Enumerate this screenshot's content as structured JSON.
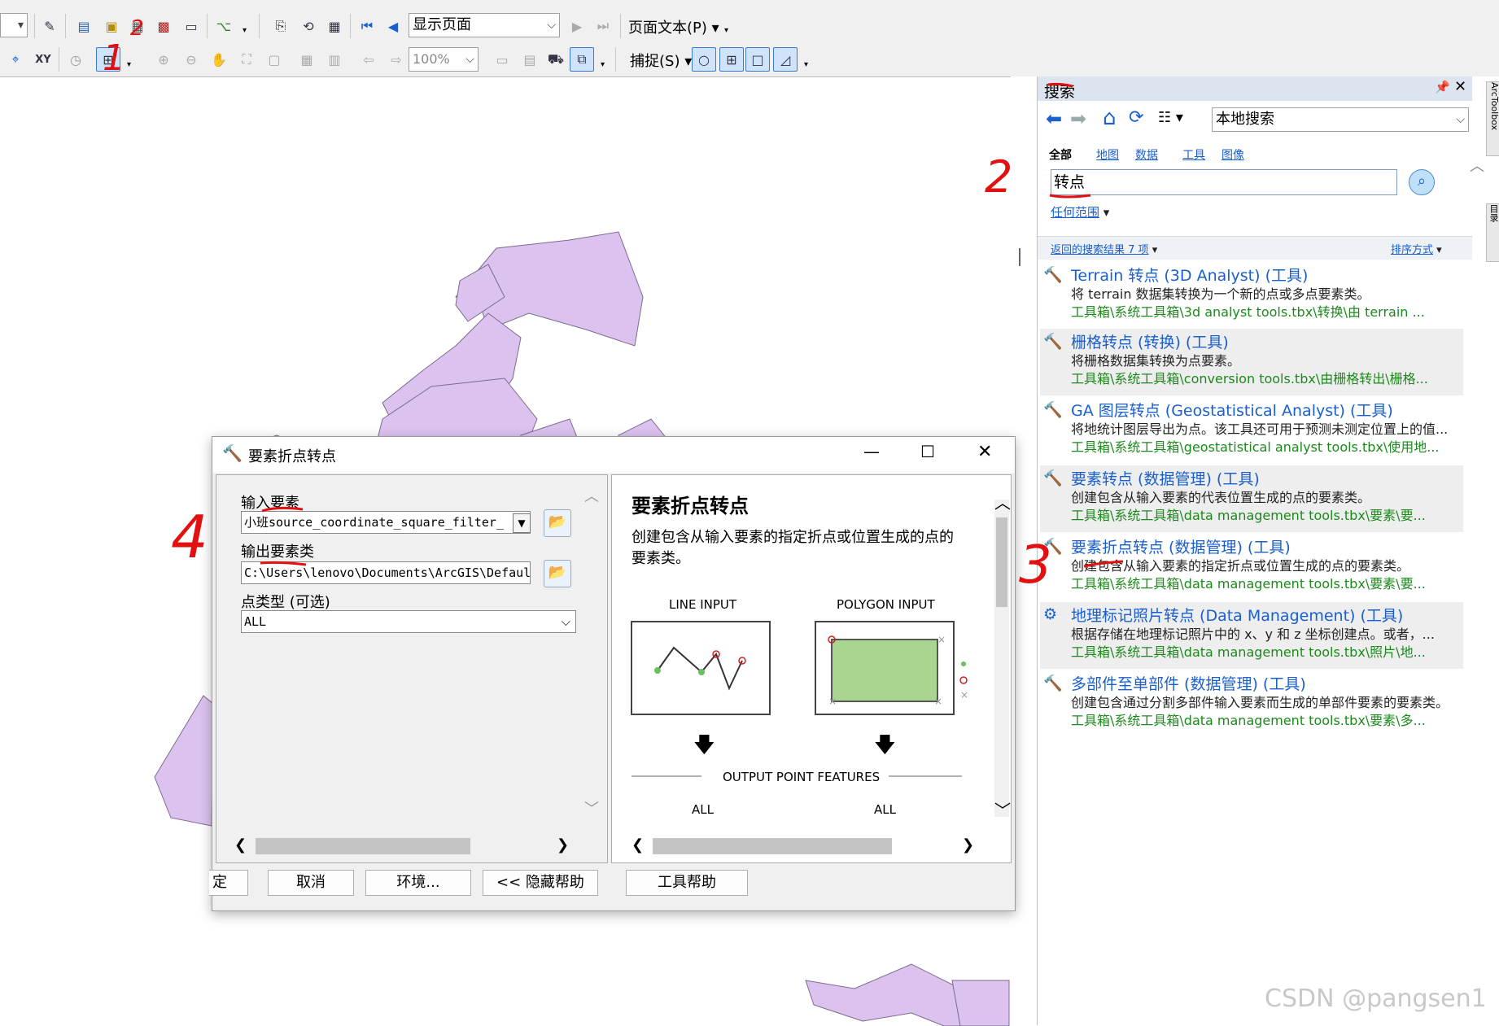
{
  "toolbar": {
    "page_combo": "显示页面",
    "page_text": "页面文本(P)",
    "zoom": "100%",
    "snap": "捕捉(S)"
  },
  "search_panel": {
    "title": "搜索",
    "scope": "本地搜索",
    "tabs": [
      "全部",
      "地图",
      "数据",
      "工具",
      "图像"
    ],
    "query": "转点",
    "any_extent": "任何范围",
    "results_count": "返回的搜索结果 7 项",
    "sort": "排序方式",
    "side_tab_1": "ArcToolbox",
    "side_tab_2": "目录",
    "results": [
      {
        "title": "Terrain 转点 (3D Analyst) (工具)",
        "desc": "将 terrain 数据集转换为一个新的点或多点要素类。",
        "path": "工具箱\\系统工具箱\\3d analyst tools.tbx\\转换\\由 terrain ..."
      },
      {
        "title": "栅格转点 (转换) (工具)",
        "desc": "将栅格数据集转换为点要素。",
        "path": "工具箱\\系统工具箱\\conversion tools.tbx\\由栅格转出\\栅格..."
      },
      {
        "title": "GA 图层转点 (Geostatistical Analyst) (工具)",
        "desc": "将地统计图层导出为点。该工具还可用于预测未测定位置上的值...",
        "path": "工具箱\\系统工具箱\\geostatistical analyst tools.tbx\\使用地..."
      },
      {
        "title": "要素转点 (数据管理) (工具)",
        "desc": "创建包含从输入要素的代表位置生成的点的要素类。",
        "path": "工具箱\\系统工具箱\\data management tools.tbx\\要素\\要..."
      },
      {
        "title": "要素折点转点 (数据管理) (工具)",
        "desc": "创建包含从输入要素的指定折点或位置生成的点的要素类。",
        "path": "工具箱\\系统工具箱\\data management tools.tbx\\要素\\要..."
      },
      {
        "title": "地理标记照片转点 (Data Management) (工具)",
        "desc": "根据存储在地理标记照片中的 x、y 和 z 坐标创建点。或者，...",
        "path": "工具箱\\系统工具箱\\data management tools.tbx\\照片\\地..."
      },
      {
        "title": "多部件至单部件 (数据管理) (工具)",
        "desc": "创建包含通过分割多部件输入要素而生成的单部件要素的要素类。",
        "path": "工具箱\\系统工具箱\\data management tools.tbx\\要素\\多..."
      }
    ]
  },
  "dialog": {
    "title": "要素折点转点",
    "input_label": "输入要素",
    "input_value": "小班source_coordinate_square_filter_",
    "output_label": "输出要素类",
    "output_value": "C:\\Users\\lenovo\\Documents\\ArcGIS\\Defaul",
    "point_type_label": "点类型 (可选)",
    "point_type_value": "ALL",
    "help_title": "要素折点转点",
    "help_desc": "创建包含从输入要素的指定折点或位置生成的点的要素类。",
    "diagram": {
      "line_input": "LINE INPUT",
      "polygon_input": "POLYGON INPUT",
      "output": "OUTPUT POINT FEATURES",
      "all_1": "ALL",
      "all_2": "ALL"
    },
    "buttons": {
      "ok": "定",
      "cancel": "取消",
      "env": "环境...",
      "hide_help": "<< 隐藏帮助",
      "tool_help": "工具帮助"
    }
  },
  "annotations": [
    "1",
    "2",
    "2",
    "3",
    "4"
  ],
  "watermark": "CSDN @pangsen1"
}
